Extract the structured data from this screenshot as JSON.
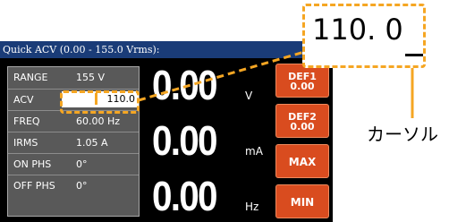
{
  "window": {
    "title": "Quick ACV (0.00 - 155.0 Vrms):"
  },
  "parameters": [
    {
      "label": "RANGE",
      "value": "155 V"
    },
    {
      "label": "ACV",
      "value": "110.0"
    },
    {
      "label": "FREQ",
      "value": "60.00 Hz"
    },
    {
      "label": "IRMS",
      "value": "1.05 A"
    },
    {
      "label": "ON PHS",
      "value": "0°"
    },
    {
      "label": "OFF PHS",
      "value": "0°"
    }
  ],
  "readouts": [
    {
      "value": "0.00",
      "unit": "V"
    },
    {
      "value": "0.00",
      "unit": "mA"
    },
    {
      "value": "0.00",
      "unit": "Hz"
    }
  ],
  "softkeys": {
    "def1": {
      "line1": "DEF1",
      "line2": "0.00"
    },
    "def2": {
      "line1": "DEF2",
      "line2": "0.00"
    },
    "max": "MAX",
    "min": "MIN"
  },
  "callout": {
    "zoom_value": "110. 0",
    "label": "カーソル"
  },
  "colors": {
    "title_bar": "#1a3c78",
    "softkey": "#d94c1f",
    "highlight": "#f5a623"
  }
}
